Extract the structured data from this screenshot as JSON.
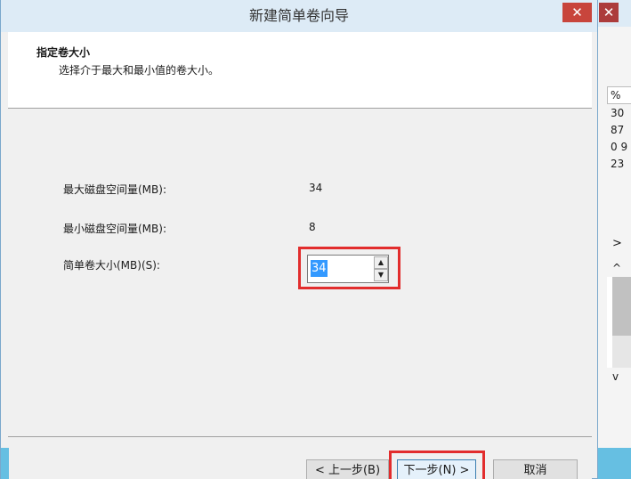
{
  "dialog": {
    "title": "新建简单卷向导",
    "close_glyph": "✕"
  },
  "header": {
    "title": "指定卷大小",
    "subtitle": "选择介于最大和最小值的卷大小。"
  },
  "fields": {
    "max_label": "最大磁盘空间量(MB):",
    "max_value": "34",
    "min_label": "最小磁盘空间量(MB):",
    "min_value": "8",
    "size_label": "简单卷大小(MB)(S):",
    "size_value": "34"
  },
  "buttons": {
    "back": "< 上一步(B)",
    "next": "下一步(N) >",
    "cancel": "取消"
  },
  "background_window": {
    "close_glyph": "✕",
    "column_header": "% ",
    "values": [
      "30",
      "87",
      "0 9",
      "23"
    ],
    "scroll_right_glyph": ">",
    "scroll_up_glyph": "^",
    "scroll_down_glyph": "v"
  },
  "colors": {
    "highlight": "#e22d2d",
    "titlebar": "#ddebf6",
    "selection": "#3399ff"
  }
}
